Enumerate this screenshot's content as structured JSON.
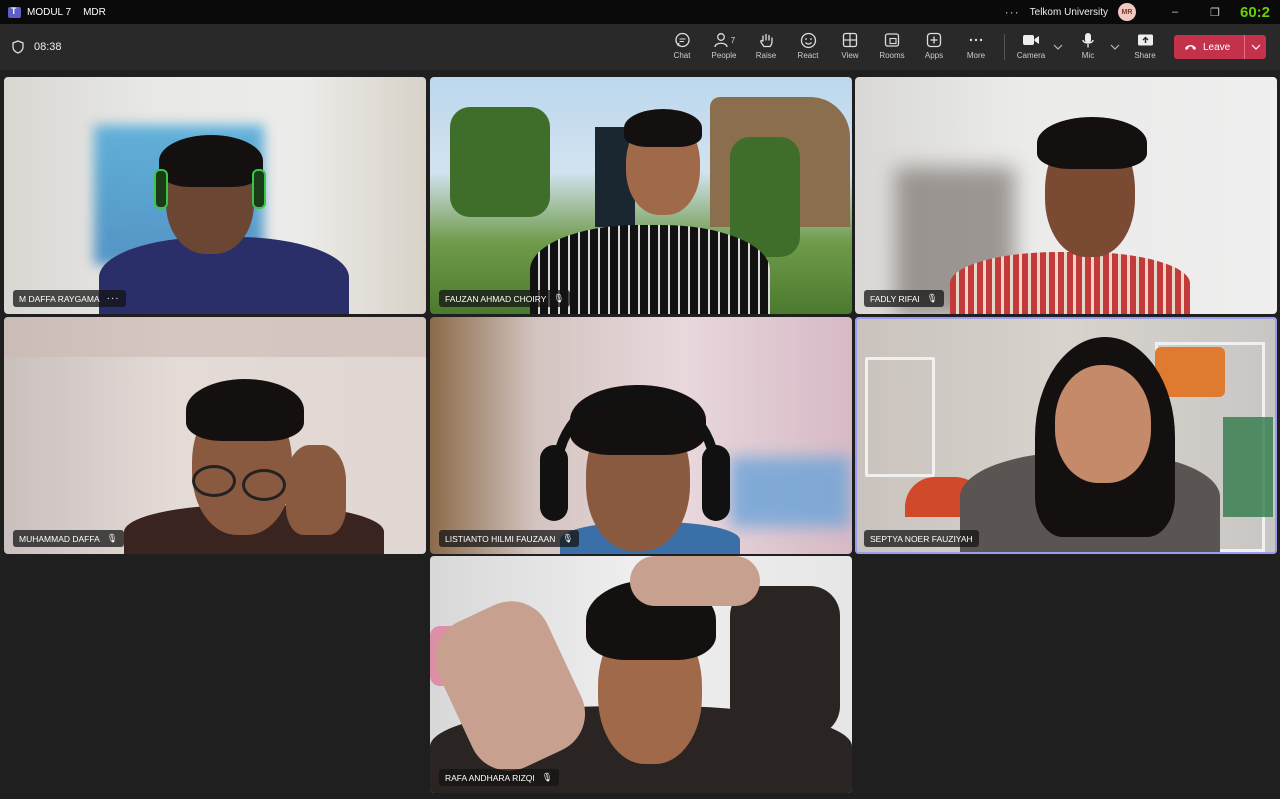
{
  "titlebar": {
    "meeting_title": "MODUL 7",
    "meeting_subtitle": "MDR",
    "more": "···",
    "org_name": "Telkom University",
    "avatar_initials": "MR",
    "timer": "60:2"
  },
  "toolbar": {
    "elapsed": "08:38",
    "chat": "Chat",
    "people": "People",
    "people_count": "7",
    "raise": "Raise",
    "react": "React",
    "view": "View",
    "rooms": "Rooms",
    "apps": "Apps",
    "more": "More",
    "camera": "Camera",
    "mic": "Mic",
    "share": "Share",
    "leave": "Leave"
  },
  "participants": [
    {
      "name": "M DAFFA RAYGAMA",
      "muted": false,
      "has_more": true
    },
    {
      "name": "FAUZAN AHMAD CHOIRY",
      "muted": true
    },
    {
      "name": "FADLY RIFAI",
      "muted": true
    },
    {
      "name": "MUHAMMAD DAFFA",
      "muted": true
    },
    {
      "name": "LISTIANTO HILMI FAUZAAN",
      "muted": true
    },
    {
      "name": "SEPTYA NOER FAUZIYAH",
      "muted": false,
      "speaking": true
    },
    {
      "name": "RAFA ANDHARA RIZQI",
      "muted": true
    }
  ],
  "colors": {
    "accent": "#5b5fc7",
    "leave": "#c4314b",
    "timer": "#6ad000",
    "active_border": "#9b9cf0"
  }
}
